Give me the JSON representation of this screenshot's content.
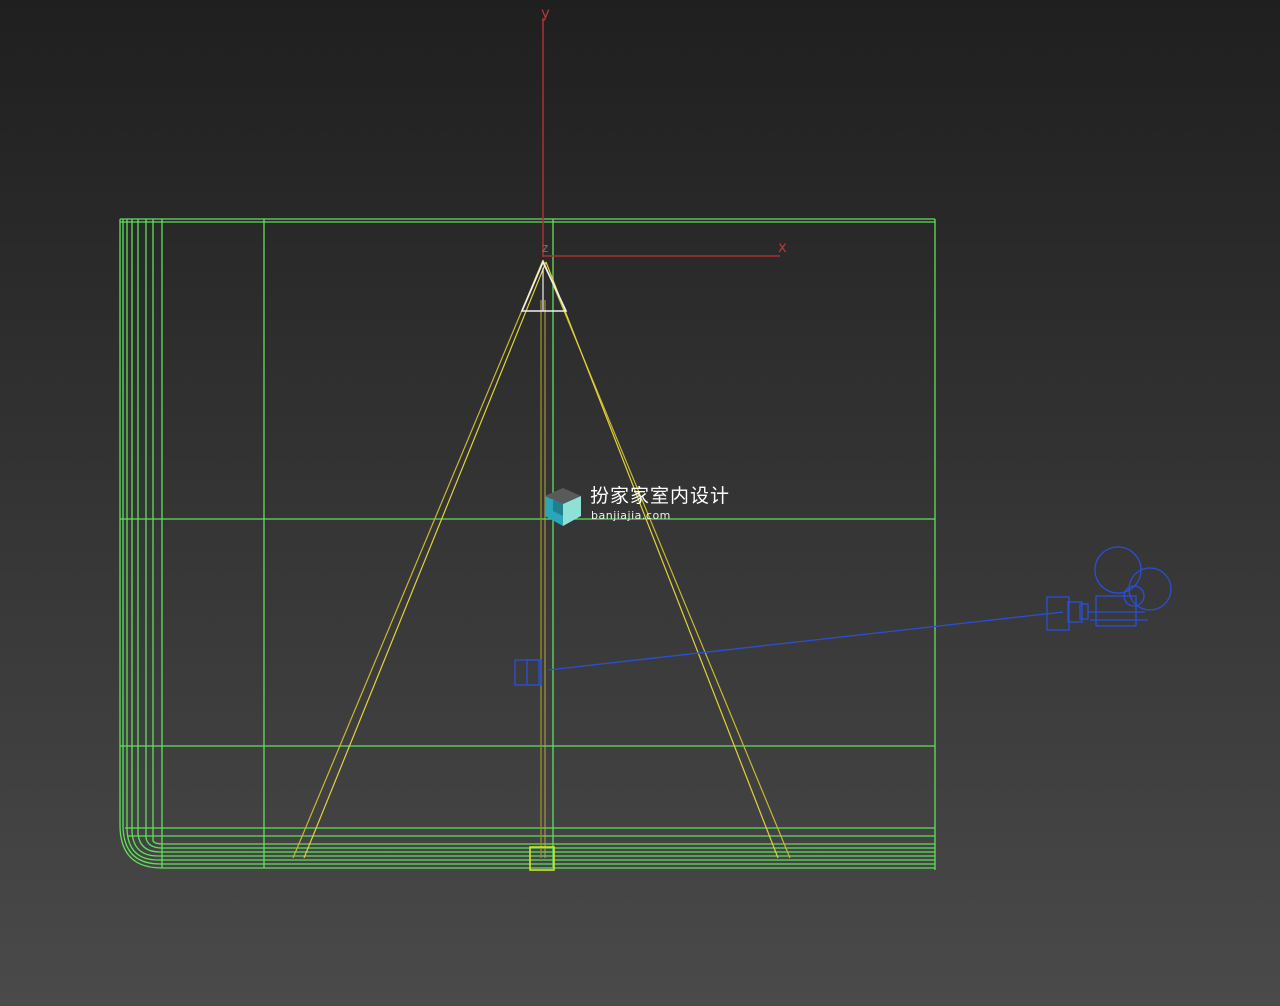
{
  "viewport": {
    "axis_labels": {
      "y": "y",
      "x": "x",
      "z": "z"
    },
    "colors": {
      "background_top": "#1f1f1f",
      "background_bottom": "#4a4a4a",
      "mesh_green": "#5fe05a",
      "light_cone_yellow": "#e2d23a",
      "light_target_yellow": "#d8e020",
      "camera_blue": "#2a4fd6",
      "axis_red": "#b03a3a",
      "gizmo_white": "#f0f0f0"
    },
    "objects": [
      {
        "type": "mesh",
        "icon": "wireframe-box-icon"
      },
      {
        "type": "spotlight",
        "icon": "spotlight-icon"
      },
      {
        "type": "camera",
        "icon": "camera-icon"
      }
    ]
  },
  "watermark": {
    "title": "扮家家室内设计",
    "url": "banjiajia.com",
    "logo_icon": "cube-logo-icon"
  }
}
